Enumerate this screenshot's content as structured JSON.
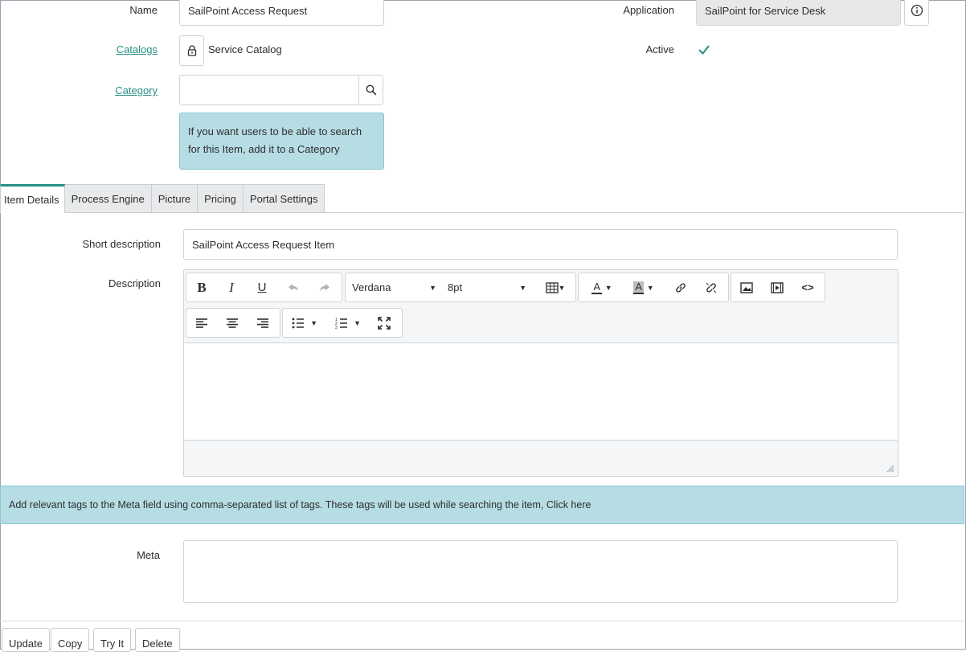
{
  "form": {
    "name_label": "Name",
    "name_value": "SailPoint Access Request",
    "catalogs_label": "Catalogs",
    "catalogs_value": "Service Catalog",
    "category_label": "Category",
    "category_value": "",
    "category_hint": "If you want users to be able to search for this Item, add it to a Category",
    "application_label": "Application",
    "application_value": "SailPoint for Service Desk",
    "active_label": "Active",
    "active_checked": true
  },
  "tabs": [
    {
      "label": "Item Details",
      "active": true
    },
    {
      "label": "Process Engine",
      "active": false
    },
    {
      "label": "Picture",
      "active": false
    },
    {
      "label": "Pricing",
      "active": false
    },
    {
      "label": "Portal Settings",
      "active": false
    }
  ],
  "details": {
    "short_description_label": "Short description",
    "short_description_value": "SailPoint Access Request Item",
    "description_label": "Description",
    "editor": {
      "font_family": "Verdana",
      "font_size": "8pt",
      "body_text": ""
    },
    "meta_hint": "Add relevant tags to the Meta field using comma-separated list of tags. These tags will be used while searching the item, Click here",
    "meta_label": "Meta",
    "meta_value": ""
  },
  "actions": {
    "update": "Update",
    "copy": "Copy",
    "try_it": "Try It",
    "delete": "Delete"
  },
  "colors": {
    "accent": "#278f83",
    "hint_bg": "#b6dde3"
  }
}
